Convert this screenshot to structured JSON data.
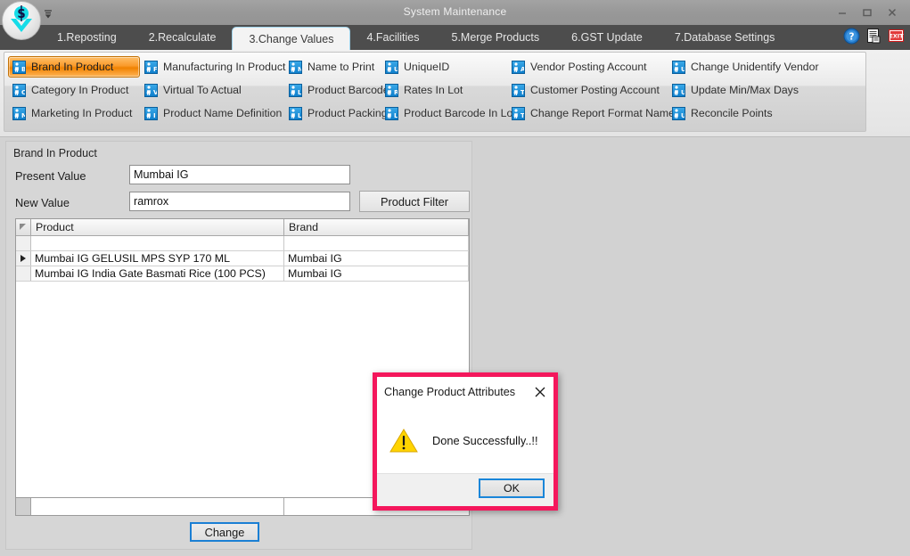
{
  "window": {
    "title": "System Maintenance",
    "minimize_label": "–",
    "maximize_label": "□",
    "close_label": "✕",
    "qat_icon": "quick-access-dropdown-icon",
    "logo_icon": "app-logo-icon"
  },
  "tabs": [
    {
      "label": "1.Reposting",
      "active": false
    },
    {
      "label": "2.Recalculate",
      "active": false
    },
    {
      "label": "3.Change Values",
      "active": true
    },
    {
      "label": "4.Facilities",
      "active": false
    },
    {
      "label": "5.Merge Products",
      "active": false
    },
    {
      "label": "6.GST Update",
      "active": false
    },
    {
      "label": "7.Database Settings",
      "active": false
    }
  ],
  "sys_icons": [
    {
      "name": "help-icon",
      "label": "?"
    },
    {
      "name": "report-icon",
      "label": ""
    },
    {
      "name": "exit-icon",
      "label": "EXIT"
    }
  ],
  "ribbon": {
    "items": [
      {
        "label": "Brand In Product",
        "glyph": "B",
        "selected": true
      },
      {
        "label": "Category In Product",
        "glyph": "C",
        "selected": false
      },
      {
        "label": "Marketing In Product",
        "glyph": "M",
        "selected": false
      },
      {
        "label": "Manufacturing In Product",
        "glyph": "F",
        "selected": false
      },
      {
        "label": "Virtual To Actual",
        "glyph": "V",
        "selected": false
      },
      {
        "label": "Product Name Definition",
        "glyph": "I",
        "selected": false
      },
      {
        "label": "Name to Print",
        "glyph": "N",
        "selected": false
      },
      {
        "label": "Product Barcode",
        "glyph": "L",
        "selected": false
      },
      {
        "label": "Product Packing",
        "glyph": "L",
        "selected": false
      },
      {
        "label": "UniqueID",
        "glyph": "U",
        "selected": false
      },
      {
        "label": "Rates In Lot",
        "glyph": "R",
        "selected": false
      },
      {
        "label": "Product Barcode In Lot",
        "glyph": "L",
        "selected": false
      },
      {
        "label": "Vendor Posting Account",
        "glyph": "A",
        "selected": false
      },
      {
        "label": "Customer Posting Account",
        "glyph": "T",
        "selected": false
      },
      {
        "label": "Change Report Format Name",
        "glyph": "T",
        "selected": false
      },
      {
        "label": "Change Unidentify Vendor",
        "glyph": "U",
        "selected": false
      },
      {
        "label": "Update Min/Max Days",
        "glyph": "U",
        "selected": false
      },
      {
        "label": "Reconcile Points",
        "glyph": "U",
        "selected": false
      }
    ]
  },
  "form": {
    "group_title": "Brand In Product",
    "present_label": "Present Value",
    "present_value": "Mumbai IG",
    "new_label": "New Value",
    "new_value": "ramrox",
    "filter_button": "Product Filter",
    "change_button": "Change"
  },
  "grid": {
    "columns": [
      "Product",
      "Brand"
    ],
    "rows": [
      {
        "product": "",
        "brand": "",
        "current": false
      },
      {
        "product": "Mumbai IG GELUSIL MPS SYP 170 ML",
        "brand": "Mumbai IG",
        "current": true
      },
      {
        "product": "Mumbai IG India Gate Basmati Rice (100 PCS)",
        "brand": "Mumbai IG",
        "current": false
      }
    ]
  },
  "dialog": {
    "title": "Change Product Attributes",
    "message": "Done Successfully..!!",
    "ok_label": "OK",
    "close_label": "✕",
    "warning_icon": "warning-triangle-icon",
    "border_color": "#f4175c"
  }
}
